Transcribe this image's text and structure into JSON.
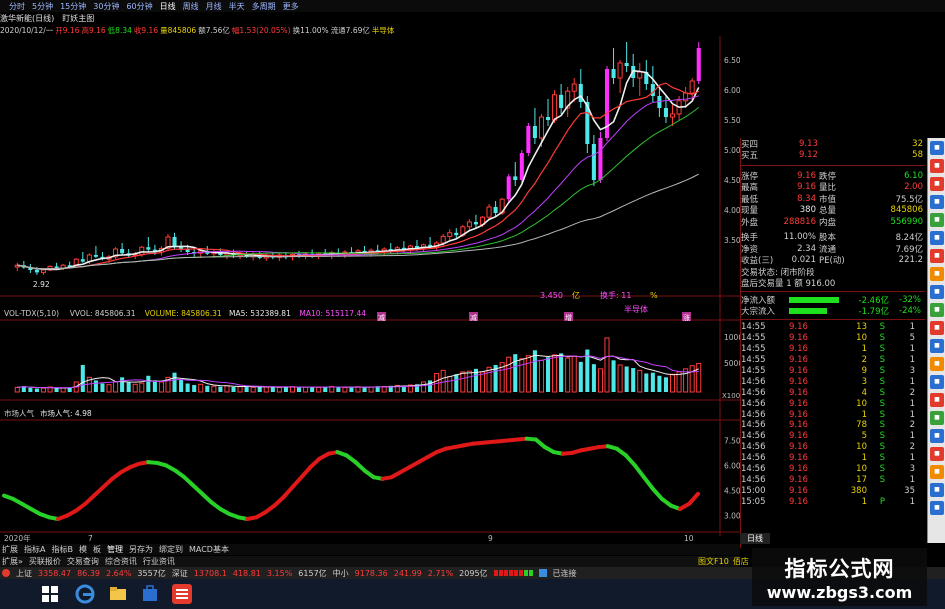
{
  "toolbar": {
    "items": [
      "",
      "分时",
      "5分钟",
      "15分钟",
      "30分钟",
      "60分钟",
      "日线",
      "周线",
      "月线",
      "半天",
      "多周期",
      "更多"
    ],
    "selected_index": 6
  },
  "title": {
    "stock": "激华新能(日线)",
    "indicator_label": "盯妖主图"
  },
  "info_line": [
    {
      "text": "2020/10/12/一",
      "color": "#d0d0d0"
    },
    {
      "text": "开9.16",
      "color": "#ff3b3b"
    },
    {
      "text": "高9.16",
      "color": "#ff3b3b"
    },
    {
      "text": "低8.34",
      "color": "#1ee01e"
    },
    {
      "text": "收9.16",
      "color": "#ff3b3b"
    },
    {
      "text": "量845806",
      "color": "#e8d400"
    },
    {
      "text": "额7.56亿",
      "color": "#d0d0d0"
    },
    {
      "text": "幅1.53(20.05%)",
      "color": "#ff3b3b"
    },
    {
      "text": "换11.00%",
      "color": "#d0d0d0"
    },
    {
      "text": "流通7.69亿",
      "color": "#d0d0d0"
    },
    {
      "text": "半导体",
      "color": "#e8d400"
    }
  ],
  "price_panel": {
    "low_marker": "2.92",
    "y_ticks": [
      "6.50",
      "6.00",
      "5.50",
      "5.00",
      "4.50",
      "4.00",
      "3.50"
    ],
    "overlay_labels": [
      {
        "text": "3.450",
        "color": "#ff4dff"
      },
      {
        "text": "亿",
        "color": "#e8d400"
      },
      {
        "text": "换手: 11",
        "color": "#ff4dff"
      },
      {
        "text": "%",
        "color": "#e8d400"
      },
      {
        "text": "半导体",
        "color": "#ff4dff"
      }
    ],
    "bottom_markers": [
      "减",
      "减",
      "增",
      "涨"
    ]
  },
  "volume_panel": {
    "header": [
      {
        "text": "VOL-TDX(5,10)",
        "color": "#d0d0d0"
      },
      {
        "text": "VVOL: 845806.31",
        "color": "#d0d0d0"
      },
      {
        "text": "VOLUME: 845806.31",
        "color": "#e8d400"
      },
      {
        "text": "MA5: 532389.81",
        "color": "#e8e8e8"
      },
      {
        "text": "MA10: 515117.44",
        "color": "#ff4dff"
      }
    ],
    "y_ticks": [
      "10000",
      "5000"
    ],
    "unit": "X100"
  },
  "sentiment_panel": {
    "header": [
      {
        "text": "市场人气",
        "color": "#d0d0d0"
      },
      {
        "text": "市场人气: 4.98",
        "color": "#e8e8e8"
      }
    ],
    "y_ticks": [
      "7.50",
      "6.00",
      "4.50",
      "3.00"
    ]
  },
  "x_axis": {
    "labels": [
      "2020年",
      "7",
      "9",
      "10"
    ]
  },
  "right_panel": {
    "quotes": [
      {
        "label": "买四",
        "value": "9.13",
        "extra": "32",
        "vcolor": "#ff3b3b"
      },
      {
        "label": "买五",
        "value": "9.12",
        "extra": "58",
        "vcolor": "#ff3b3b"
      }
    ],
    "stats": [
      {
        "l1": "涨停",
        "v1": "9.16",
        "c1": "#ff3b3b",
        "l2": "跌停",
        "v2": "6.10",
        "c2": "#1ee01e"
      },
      {
        "l1": "最高",
        "v1": "9.16",
        "c1": "#ff3b3b",
        "l2": "量比",
        "v2": "2.00",
        "c2": "#ff3b3b"
      },
      {
        "l1": "最低",
        "v1": "8.34",
        "c1": "#ff3b3b",
        "l2": "市值",
        "v2": "75.5亿",
        "c2": "#d0d0d0"
      },
      {
        "l1": "现量",
        "v1": "380",
        "c1": "#e8e8e8",
        "l2": "总量",
        "v2": "845806",
        "c2": "#e8d400"
      },
      {
        "l1": "外盘",
        "v1": "288816",
        "c1": "#ff3b3b",
        "l2": "内盘",
        "v2": "556990",
        "c2": "#1ee01e"
      },
      {
        "l1": "换手",
        "v1": "11.00%",
        "c1": "#d0d0d0",
        "l2": "股本",
        "v2": "8.24亿",
        "c2": "#d0d0d0"
      },
      {
        "l1": "净资",
        "v1": "2.34",
        "c1": "#d0d0d0",
        "l2": "流通",
        "v2": "7.69亿",
        "c2": "#d0d0d0"
      },
      {
        "l1": "收益(三)",
        "v1": "0.021",
        "c1": "#d0d0d0",
        "l2": "PE(动)",
        "v2": "221.2",
        "c2": "#d0d0d0"
      }
    ],
    "status_line": "交易状态: 闭市阶段",
    "after_hours": "盘后交易量 1 额 916.00",
    "flows": [
      {
        "label": "净流入额",
        "value": "-2.46亿",
        "pct": "-32%",
        "color": "#1ee01e",
        "fill": 0.32
      },
      {
        "label": "大宗流入",
        "value": "-1.79亿",
        "pct": "-24%",
        "color": "#1ee01e",
        "fill": 0.24
      }
    ],
    "trades": [
      {
        "time": "14:55",
        "price": "9.16",
        "vol": "13",
        "dir": "S",
        "n": "1"
      },
      {
        "time": "14:55",
        "price": "9.16",
        "vol": "10",
        "dir": "S",
        "n": "5"
      },
      {
        "time": "14:55",
        "price": "9.16",
        "vol": "1",
        "dir": "S",
        "n": "1"
      },
      {
        "time": "14:55",
        "price": "9.16",
        "vol": "2",
        "dir": "S",
        "n": "1"
      },
      {
        "time": "14:55",
        "price": "9.16",
        "vol": "9",
        "dir": "S",
        "n": "3"
      },
      {
        "time": "14:56",
        "price": "9.16",
        "vol": "3",
        "dir": "S",
        "n": "1"
      },
      {
        "time": "14:56",
        "price": "9.16",
        "vol": "4",
        "dir": "S",
        "n": "2"
      },
      {
        "time": "14:56",
        "price": "9.16",
        "vol": "10",
        "dir": "S",
        "n": "1"
      },
      {
        "time": "14:56",
        "price": "9.16",
        "vol": "1",
        "dir": "S",
        "n": "1"
      },
      {
        "time": "14:56",
        "price": "9.16",
        "vol": "78",
        "dir": "S",
        "n": "2"
      },
      {
        "time": "14:56",
        "price": "9.16",
        "vol": "5",
        "dir": "S",
        "n": "1"
      },
      {
        "time": "14:56",
        "price": "9.16",
        "vol": "10",
        "dir": "S",
        "n": "2"
      },
      {
        "time": "14:56",
        "price": "9.16",
        "vol": "1",
        "dir": "S",
        "n": "1"
      },
      {
        "time": "14:56",
        "price": "9.16",
        "vol": "10",
        "dir": "S",
        "n": "3"
      },
      {
        "time": "14:56",
        "price": "9.16",
        "vol": "17",
        "dir": "S",
        "n": "1"
      },
      {
        "time": "15:00",
        "price": "9.16",
        "vol": "380",
        "dir": "",
        "n": "35"
      },
      {
        "time": "15:05",
        "price": "9.16",
        "vol": "1",
        "dir": "P",
        "n": "1"
      }
    ],
    "bottom_right": [
      "图文F10",
      "佰店"
    ]
  },
  "tabbar": [
    "扩展",
    "指标A",
    "指标B",
    "模",
    "板",
    "管理",
    "另存为",
    "绑定到",
    "MACD基本"
  ],
  "tabbar2": [
    "扩展»",
    "买联报价",
    "交易查询",
    "综合资讯",
    "行业资讯"
  ],
  "right_tab": "日线",
  "index_bar": [
    {
      "text": "上证",
      "color": "#d0d0d0"
    },
    {
      "text": "3358.47",
      "color": "#ff3b3b"
    },
    {
      "text": "86.39",
      "color": "#ff3b3b"
    },
    {
      "text": "2.64%",
      "color": "#ff3b3b"
    },
    {
      "text": "3557亿",
      "color": "#d0d0d0"
    },
    {
      "text": "深证",
      "color": "#d0d0d0"
    },
    {
      "text": "13708.1",
      "color": "#ff3b3b"
    },
    {
      "text": "418.81",
      "color": "#ff3b3b"
    },
    {
      "text": "3.15%",
      "color": "#ff3b3b"
    },
    {
      "text": "6157亿",
      "color": "#d0d0d0"
    },
    {
      "text": "中小",
      "color": "#d0d0d0"
    },
    {
      "text": "9178.36",
      "color": "#ff3b3b"
    },
    {
      "text": "241.99",
      "color": "#ff3b3b"
    },
    {
      "text": "2.71%",
      "color": "#ff3b3b"
    },
    {
      "text": "2095亿",
      "color": "#d0d0d0"
    },
    {
      "text": "已连接",
      "color": "#d0d0d0"
    }
  ],
  "watermark": {
    "line1": "指标公式网",
    "line2": "www.zbgs3.com"
  },
  "colors": {
    "up": "#ff3b3b",
    "down": "#4ee8e8",
    "limit_up": "#ff30ff",
    "ma_white": "#f0f0f0",
    "ma_red": "#ff3b3b",
    "ma_mag": "#c040ff",
    "ma_green": "#2fc02f",
    "ma_gray": "#b8b8b8"
  },
  "chart_data": {
    "type": "candlestick",
    "note_series": "daily OHLC approximations read from chart",
    "candles": [
      [
        3.05,
        3.12,
        2.98,
        3.08
      ],
      [
        3.08,
        3.15,
        3.02,
        3.04
      ],
      [
        3.04,
        3.1,
        2.95,
        3.0
      ],
      [
        3.0,
        3.05,
        2.92,
        2.96
      ],
      [
        2.96,
        3.02,
        2.92,
        3.0
      ],
      [
        3.0,
        3.08,
        2.98,
        3.06
      ],
      [
        3.06,
        3.12,
        3.01,
        3.03
      ],
      [
        3.03,
        3.1,
        3.0,
        3.08
      ],
      [
        3.08,
        3.14,
        3.03,
        3.05
      ],
      [
        3.05,
        3.2,
        3.04,
        3.18
      ],
      [
        3.18,
        3.3,
        3.12,
        3.14
      ],
      [
        3.14,
        3.28,
        3.1,
        3.25
      ],
      [
        3.25,
        3.4,
        3.2,
        3.22
      ],
      [
        3.22,
        3.3,
        3.16,
        3.18
      ],
      [
        3.18,
        3.25,
        3.12,
        3.22
      ],
      [
        3.22,
        3.38,
        3.18,
        3.35
      ],
      [
        3.35,
        3.45,
        3.25,
        3.28
      ],
      [
        3.28,
        3.35,
        3.2,
        3.24
      ],
      [
        3.24,
        3.3,
        3.18,
        3.26
      ],
      [
        3.26,
        3.4,
        3.22,
        3.38
      ],
      [
        3.38,
        3.55,
        3.3,
        3.34
      ],
      [
        3.34,
        3.42,
        3.25,
        3.3
      ],
      [
        3.3,
        3.4,
        3.24,
        3.36
      ],
      [
        3.36,
        3.6,
        3.32,
        3.55
      ],
      [
        3.55,
        3.62,
        3.35,
        3.4
      ],
      [
        3.4,
        3.48,
        3.3,
        3.35
      ],
      [
        3.35,
        3.42,
        3.25,
        3.3
      ],
      [
        3.3,
        3.38,
        3.22,
        3.28
      ],
      [
        3.28,
        3.35,
        3.2,
        3.32
      ],
      [
        3.32,
        3.4,
        3.25,
        3.27
      ],
      [
        3.27,
        3.35,
        3.2,
        3.3
      ],
      [
        3.3,
        3.36,
        3.22,
        3.25
      ],
      [
        3.25,
        3.32,
        3.18,
        3.28
      ],
      [
        3.28,
        3.34,
        3.2,
        3.24
      ],
      [
        3.24,
        3.3,
        3.18,
        3.26
      ],
      [
        3.26,
        3.32,
        3.2,
        3.22
      ],
      [
        3.22,
        3.3,
        3.16,
        3.25
      ],
      [
        3.25,
        3.3,
        3.18,
        3.2
      ],
      [
        3.2,
        3.28,
        3.15,
        3.24
      ],
      [
        3.24,
        3.3,
        3.18,
        3.21
      ],
      [
        3.21,
        3.28,
        3.15,
        3.25
      ],
      [
        3.25,
        3.3,
        3.18,
        3.22
      ],
      [
        3.22,
        3.28,
        3.16,
        3.26
      ],
      [
        3.26,
        3.32,
        3.2,
        3.23
      ],
      [
        3.23,
        3.3,
        3.18,
        3.27
      ],
      [
        3.27,
        3.34,
        3.2,
        3.24
      ],
      [
        3.24,
        3.3,
        3.18,
        3.28
      ],
      [
        3.28,
        3.35,
        3.22,
        3.25
      ],
      [
        3.25,
        3.32,
        3.18,
        3.29
      ],
      [
        3.29,
        3.36,
        3.22,
        3.26
      ],
      [
        3.26,
        3.33,
        3.2,
        3.3
      ],
      [
        3.3,
        3.38,
        3.24,
        3.27
      ],
      [
        3.27,
        3.35,
        3.22,
        3.32
      ],
      [
        3.32,
        3.4,
        3.25,
        3.28
      ],
      [
        3.28,
        3.36,
        3.22,
        3.33
      ],
      [
        3.33,
        3.42,
        3.26,
        3.3
      ],
      [
        3.3,
        3.38,
        3.24,
        3.35
      ],
      [
        3.35,
        3.45,
        3.28,
        3.32
      ],
      [
        3.32,
        3.4,
        3.26,
        3.37
      ],
      [
        3.37,
        3.48,
        3.3,
        3.34
      ],
      [
        3.34,
        3.42,
        3.28,
        3.4
      ],
      [
        3.4,
        3.5,
        3.32,
        3.36
      ],
      [
        3.36,
        3.44,
        3.3,
        3.42
      ],
      [
        3.42,
        3.55,
        3.35,
        3.38
      ],
      [
        3.38,
        3.48,
        3.32,
        3.45
      ],
      [
        3.45,
        3.6,
        3.38,
        3.56
      ],
      [
        3.56,
        3.68,
        3.48,
        3.62
      ],
      [
        3.62,
        3.7,
        3.52,
        3.58
      ],
      [
        3.58,
        3.75,
        3.55,
        3.72
      ],
      [
        3.72,
        3.85,
        3.65,
        3.8
      ],
      [
        3.8,
        3.92,
        3.7,
        3.76
      ],
      [
        3.76,
        3.9,
        3.72,
        3.88
      ],
      [
        3.88,
        4.1,
        3.84,
        4.05
      ],
      [
        4.05,
        4.15,
        3.9,
        3.95
      ],
      [
        3.95,
        4.2,
        3.92,
        4.18
      ],
      [
        4.18,
        4.6,
        4.12,
        4.56
      ],
      [
        4.56,
        4.8,
        4.4,
        4.5
      ],
      [
        4.5,
        5.0,
        4.45,
        4.95
      ],
      [
        4.95,
        5.45,
        4.9,
        5.4
      ],
      [
        5.4,
        5.7,
        5.1,
        5.2
      ],
      [
        5.2,
        5.6,
        5.05,
        5.55
      ],
      [
        5.55,
        5.85,
        5.4,
        5.5
      ],
      [
        5.5,
        6.0,
        5.45,
        5.92
      ],
      [
        5.92,
        6.1,
        5.6,
        5.7
      ],
      [
        5.7,
        6.05,
        5.55,
        5.98
      ],
      [
        5.98,
        6.2,
        5.8,
        6.1
      ],
      [
        6.1,
        6.35,
        5.7,
        5.8
      ],
      [
        5.8,
        5.9,
        4.95,
        5.1
      ],
      [
        5.1,
        5.25,
        4.4,
        4.5
      ],
      [
        4.5,
        5.3,
        4.45,
        5.2
      ],
      [
        5.2,
        6.4,
        5.15,
        6.35
      ],
      [
        6.35,
        6.7,
        6.1,
        6.2
      ],
      [
        6.2,
        6.5,
        5.95,
        6.45
      ],
      [
        6.45,
        6.8,
        6.3,
        6.4
      ],
      [
        6.4,
        6.6,
        6.05,
        6.2
      ],
      [
        6.2,
        6.45,
        5.9,
        6.3
      ],
      [
        6.3,
        6.5,
        6.0,
        6.1
      ],
      [
        6.1,
        6.4,
        5.8,
        5.9
      ],
      [
        5.9,
        6.05,
        5.55,
        5.7
      ],
      [
        5.7,
        5.9,
        5.45,
        5.55
      ],
      [
        5.55,
        5.75,
        5.4,
        5.6
      ],
      [
        5.6,
        5.9,
        5.5,
        5.82
      ],
      [
        5.82,
        6.05,
        5.7,
        5.95
      ],
      [
        5.95,
        6.2,
        5.8,
        6.15
      ],
      [
        6.15,
        6.8,
        6.1,
        6.7
      ]
    ],
    "volume": [
      120,
      150,
      110,
      90,
      100,
      130,
      95,
      105,
      110,
      260,
      700,
      380,
      300,
      220,
      190,
      260,
      380,
      250,
      200,
      230,
      420,
      300,
      260,
      380,
      500,
      320,
      220,
      180,
      200,
      160,
      150,
      140,
      160,
      130,
      140,
      150,
      120,
      130,
      140,
      125,
      120,
      130,
      140,
      115,
      125,
      135,
      120,
      130,
      145,
      120,
      115,
      125,
      135,
      120,
      130,
      150,
      140,
      160,
      170,
      150,
      180,
      200,
      260,
      300,
      480,
      560,
      400,
      460,
      520,
      540,
      600,
      520,
      640,
      700,
      760,
      900,
      980,
      860,
      940,
      1080,
      820,
      900,
      960,
      1000,
      880,
      920,
      780,
      1100,
      720,
      600,
      1400,
      820,
      700,
      660,
      620,
      560,
      480,
      500,
      420,
      380,
      460,
      520,
      600,
      680,
      740
    ],
    "sentiment": [
      4.2,
      4.0,
      3.7,
      3.4,
      3.1,
      2.9,
      2.8,
      3.0,
      3.3,
      3.7,
      4.2,
      4.7,
      5.2,
      5.6,
      5.9,
      6.1,
      6.2,
      6.15,
      6.0,
      5.7,
      5.3,
      4.8,
      4.3,
      3.8,
      3.4,
      3.1,
      2.9,
      2.8,
      2.9,
      3.2,
      3.6,
      4.1,
      4.7,
      5.3,
      5.9,
      6.4,
      6.7,
      6.8,
      6.6,
      6.2,
      5.7,
      5.3,
      5.2,
      5.3,
      5.6,
      5.9,
      6.2,
      6.5,
      6.8,
      7.0,
      7.1,
      7.2,
      7.3,
      7.35,
      7.4,
      7.45,
      7.5,
      7.55,
      7.6,
      7.55,
      7.1,
      6.8,
      6.7,
      6.75,
      6.9,
      7.0,
      7.1,
      7.15,
      7.0,
      6.6,
      6.0,
      5.3,
      4.6,
      4.0,
      3.6,
      3.4,
      3.7,
      4.3
    ],
    "ylim_price": [
      2.8,
      6.9
    ],
    "volume_ylim": [
      0,
      1450
    ],
    "sentiment_ylim": [
      2.5,
      8.0
    ]
  }
}
